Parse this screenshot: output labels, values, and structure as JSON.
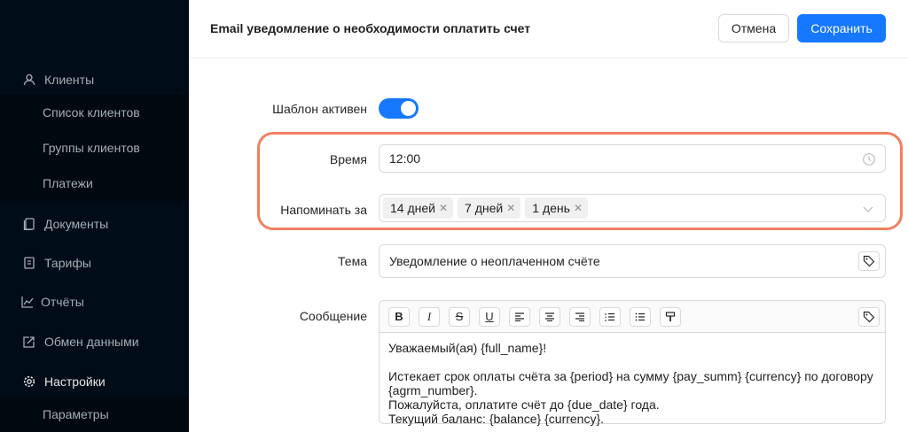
{
  "sidebar": {
    "groups": [
      {
        "label": "Клиенты",
        "icon": "user-icon"
      },
      {
        "label": "Документы",
        "icon": "document-icon"
      },
      {
        "label": "Тарифы",
        "icon": "tariff-icon"
      },
      {
        "label": "Отчёты",
        "icon": "chart-icon"
      },
      {
        "label": "Обмен данными",
        "icon": "exchange-icon"
      },
      {
        "label": "Настройки",
        "icon": "gear-icon"
      }
    ],
    "clients_sub": [
      "Список клиентов",
      "Группы клиентов",
      "Платежи"
    ],
    "settings_sub": [
      "Параметры"
    ]
  },
  "header": {
    "title": "Email уведомление о необходимости оплатить счет",
    "cancel_label": "Отмена",
    "save_label": "Сохранить"
  },
  "form": {
    "active_label": "Шаблон активен",
    "active_value": true,
    "time_label": "Время",
    "time_value": "12:00",
    "remind_label": "Напоминать за",
    "remind_tags": [
      "14 дней",
      "7 дней",
      "1 день"
    ],
    "subject_label": "Тема",
    "subject_value": "Уведомление о неоплаченном счёте",
    "message_label": "Сообщение",
    "message_lines": [
      "Уважаемый(ая) {full_name}!",
      "",
      "Истекает срок оплаты счёта за {period} на сумму {pay_summ} {currency} по договору {agrm_number}.",
      "Пожалуйста, оплатите счёт до {due_date} года.",
      "Текущий баланс: {balance} {currency}."
    ]
  },
  "colors": {
    "sidebar_bg": "#000c17",
    "primary": "#1677ff",
    "highlight": "#f08060"
  }
}
